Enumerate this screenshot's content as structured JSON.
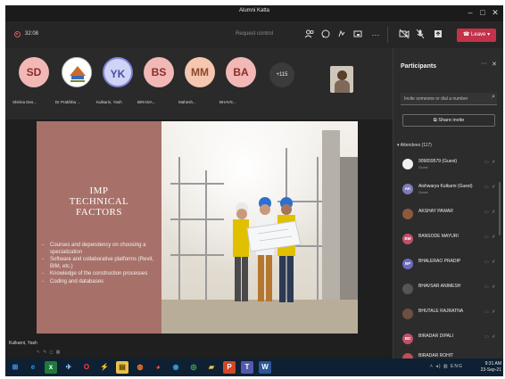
{
  "window": {
    "title": "Alumni Katta"
  },
  "toolbar": {
    "timer": "32:08",
    "request_control": "Request control",
    "leave_label": "Leave",
    "leave_color": "#c4314b"
  },
  "strip": {
    "avatars": [
      {
        "initials": "SD",
        "name": "Shirina Des...",
        "bg": "#f2b8b5",
        "fg": "#8a2c2c"
      },
      {
        "initials": "",
        "name": "Dr Prabhha ...",
        "bg": "#ffffff",
        "fg": "#333333"
      },
      {
        "initials": "YK",
        "name": "Kulkarni, Yash",
        "bg": "#cfd3f5",
        "fg": "#4a4f9c"
      },
      {
        "initials": "BS",
        "name": "BIRADA...",
        "bg": "#f2b8b5",
        "fg": "#8a2c2c"
      },
      {
        "initials": "MM",
        "name": "Mahesh...",
        "bg": "#f5c6b0",
        "fg": "#8a4a2c"
      },
      {
        "initials": "BA",
        "name": "BHAVS...",
        "bg": "#f2b8b5",
        "fg": "#8a2c2c"
      }
    ],
    "more_count": "+115"
  },
  "slide": {
    "title_lines": [
      "IMP",
      "TECHNICAL",
      "FACTORS"
    ],
    "bullets": [
      "Courses and dependency on choosing a specialization",
      "Software and collaborative platforms (Revit, BIM, etc.)",
      "Knowledge of the construction processes",
      "Coding and databases"
    ],
    "presenter": "Kulkarni, Yash"
  },
  "participants": {
    "title": "Participants",
    "invite_placeholder": "Invite someone or dial a number",
    "share_label": "Share invite",
    "attendees_header": "Attendees (117)",
    "attendees": [
      {
        "initials": "",
        "name": "909659579 (Guest)",
        "sub": "Guest",
        "color": "#f0f0f0"
      },
      {
        "initials": "AK",
        "name": "Aishwarya Kulkarni (Guest)",
        "sub": "Guest",
        "color": "#7e7bb8"
      },
      {
        "initials": "",
        "name": "AKSHAY PAWAR",
        "sub": "",
        "color": "#8b5a3c"
      },
      {
        "initials": "BM",
        "name": "BANSODE MAYURI",
        "sub": "",
        "color": "#c0506a"
      },
      {
        "initials": "BP",
        "name": "BHALERAO PRADIP",
        "sub": "",
        "color": "#6a6ac0"
      },
      {
        "initials": "",
        "name": "BHAVSAR ANIMESH",
        "sub": "",
        "color": "#555555"
      },
      {
        "initials": "",
        "name": "BHUTALE RAJRATNA",
        "sub": "",
        "color": "#6d5040"
      },
      {
        "initials": "BD",
        "name": "BIRADAR DIPALI",
        "sub": "",
        "color": "#c0506a"
      },
      {
        "initials": "",
        "name": "BIRADAR ROHIT",
        "sub": "",
        "color": "#c05050"
      }
    ]
  },
  "taskbar": {
    "time": "9:31 AM",
    "date": "23-Sep-21"
  }
}
